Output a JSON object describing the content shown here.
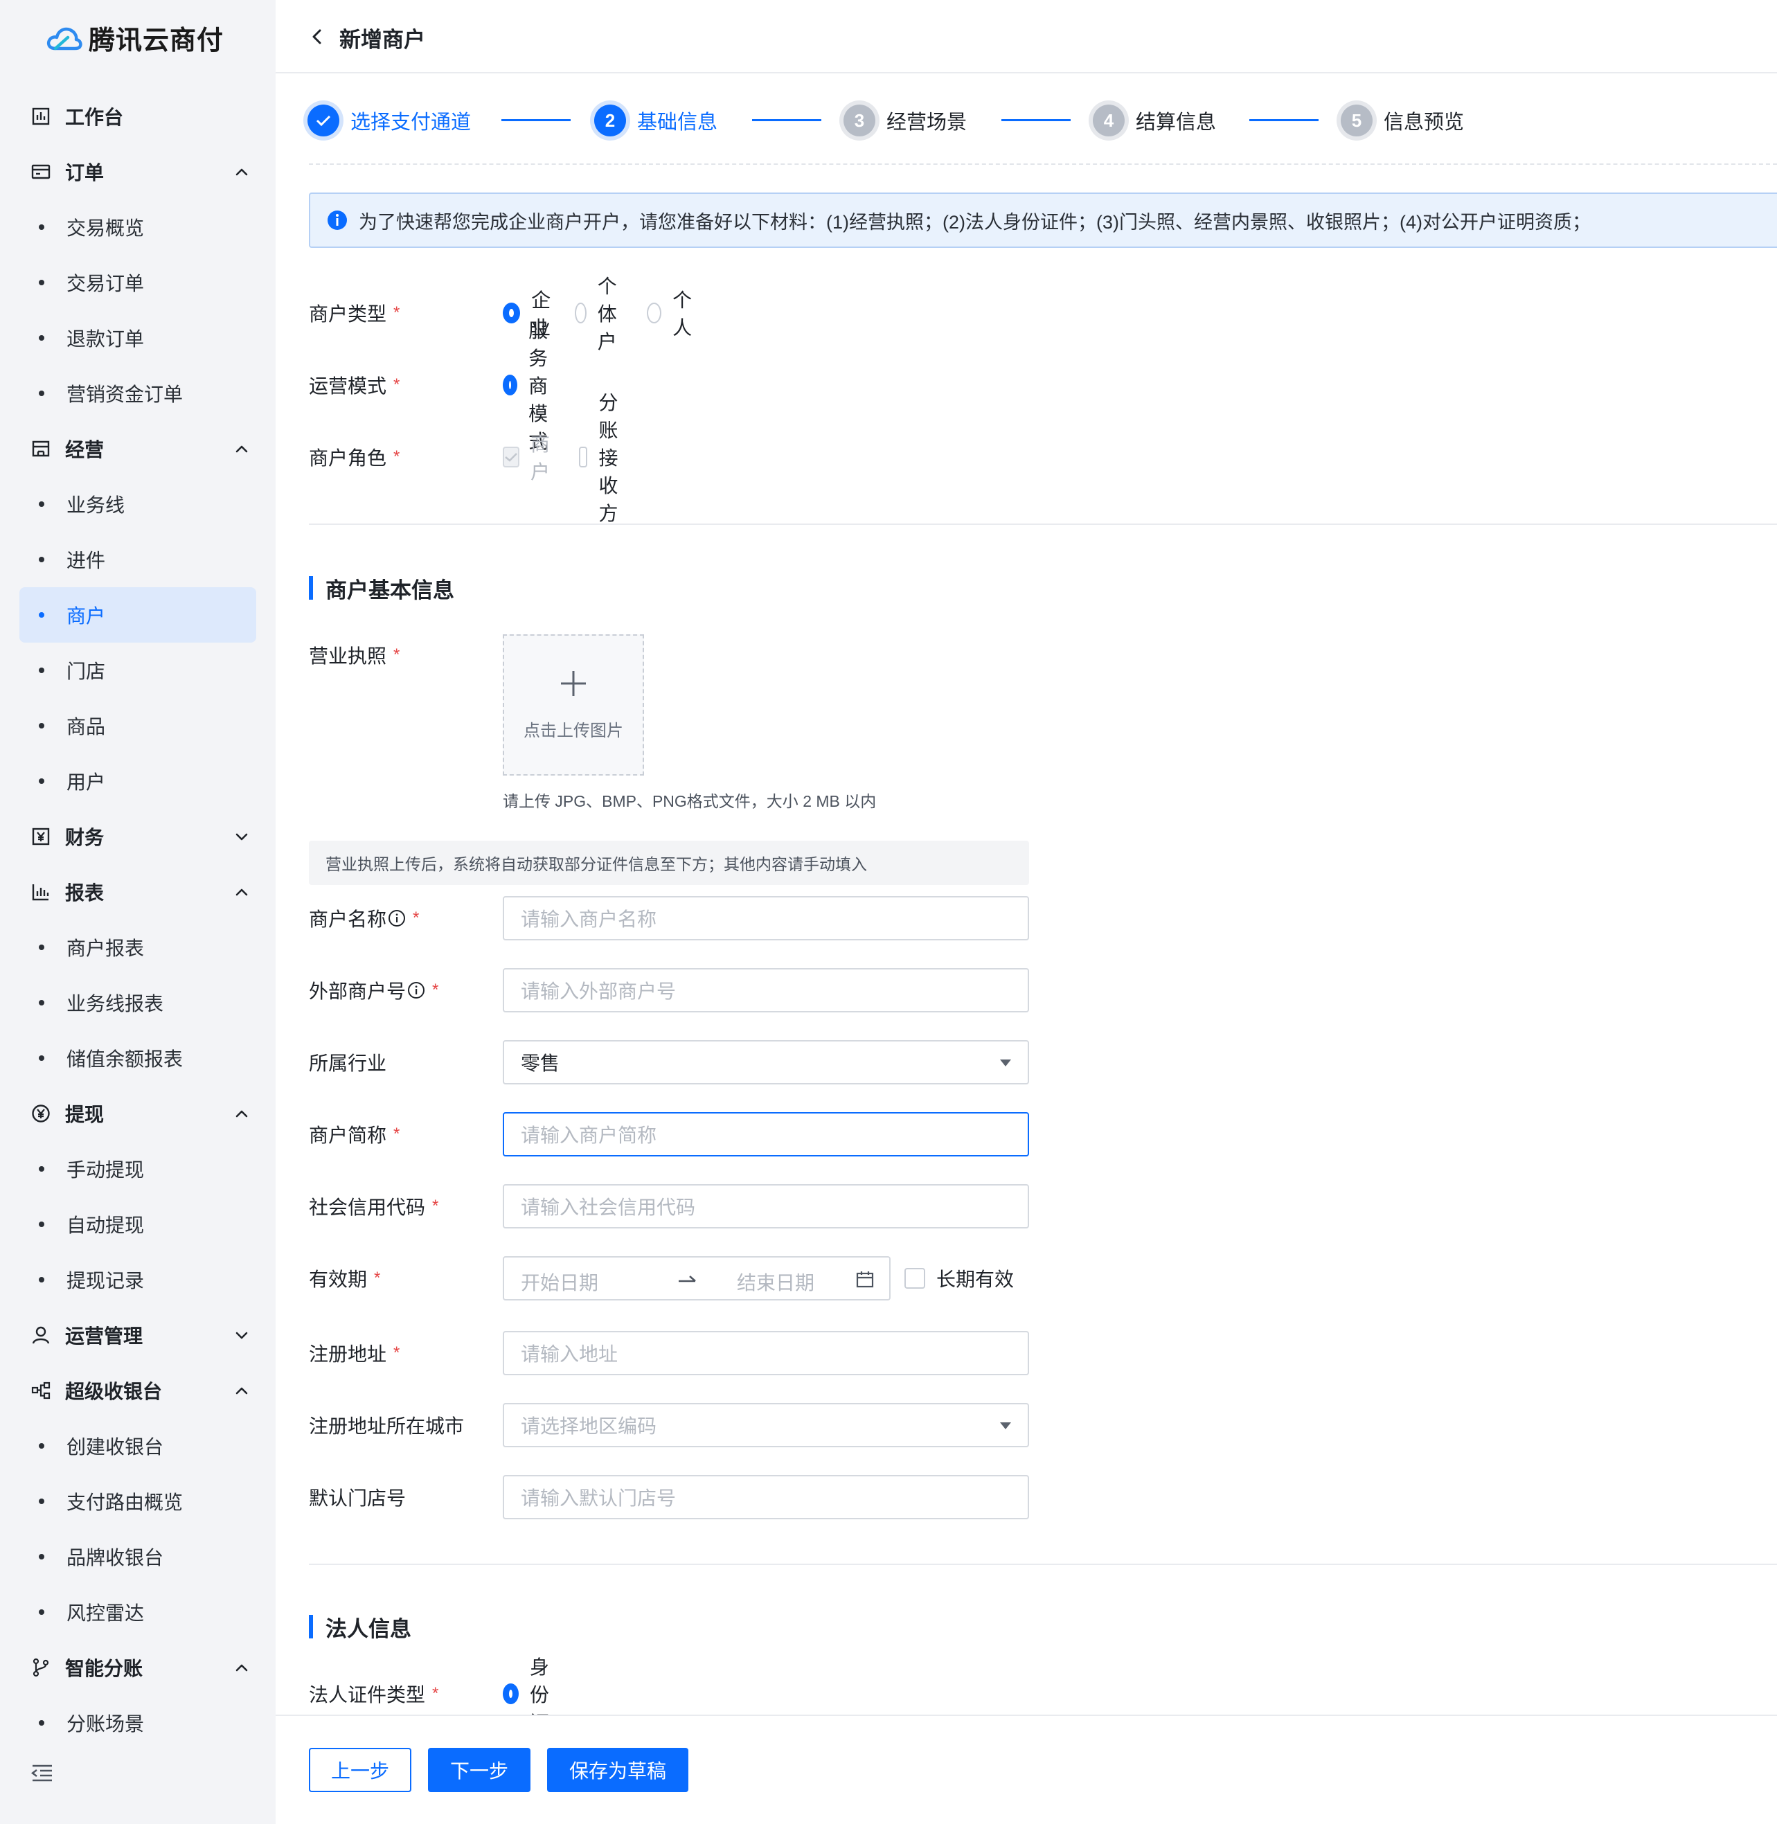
{
  "app": {
    "name": "腾讯云商付"
  },
  "sidebar": {
    "items": [
      {
        "type": "group",
        "label": "工作台",
        "icon": "dashboard-icon"
      },
      {
        "type": "group",
        "label": "订单",
        "icon": "order-icon",
        "expanded": true
      },
      {
        "type": "sub",
        "label": "交易概览"
      },
      {
        "type": "sub",
        "label": "交易订单"
      },
      {
        "type": "sub",
        "label": "退款订单"
      },
      {
        "type": "sub",
        "label": "营销资金订单"
      },
      {
        "type": "group",
        "label": "经营",
        "icon": "store-icon",
        "expanded": true
      },
      {
        "type": "sub",
        "label": "业务线"
      },
      {
        "type": "sub",
        "label": "进件"
      },
      {
        "type": "sub",
        "label": "商户",
        "active": true
      },
      {
        "type": "sub",
        "label": "门店"
      },
      {
        "type": "sub",
        "label": "商品"
      },
      {
        "type": "sub",
        "label": "用户"
      },
      {
        "type": "group",
        "label": "财务",
        "icon": "finance-icon",
        "expanded": false
      },
      {
        "type": "group",
        "label": "报表",
        "icon": "chart-icon",
        "expanded": true
      },
      {
        "type": "sub",
        "label": "商户报表"
      },
      {
        "type": "sub",
        "label": "业务线报表"
      },
      {
        "type": "sub",
        "label": "储值余额报表"
      },
      {
        "type": "group",
        "label": "提现",
        "icon": "withdraw-icon",
        "expanded": true
      },
      {
        "type": "sub",
        "label": "手动提现"
      },
      {
        "type": "sub",
        "label": "自动提现"
      },
      {
        "type": "sub",
        "label": "提现记录"
      },
      {
        "type": "group",
        "label": "运营管理",
        "icon": "user-icon",
        "expanded": false
      },
      {
        "type": "group",
        "label": "超级收银台",
        "icon": "cashier-icon",
        "expanded": true
      },
      {
        "type": "sub",
        "label": "创建收银台"
      },
      {
        "type": "sub",
        "label": "支付路由概览"
      },
      {
        "type": "sub",
        "label": "品牌收银台"
      },
      {
        "type": "sub",
        "label": "风控雷达"
      },
      {
        "type": "group",
        "label": "智能分账",
        "icon": "split-icon",
        "expanded": true
      },
      {
        "type": "sub",
        "label": "分账场景"
      }
    ]
  },
  "header": {
    "title": "新增商户"
  },
  "steps": [
    {
      "num": "1",
      "label": "选择支付通道",
      "state": "done"
    },
    {
      "num": "2",
      "label": "基础信息",
      "state": "current"
    },
    {
      "num": "3",
      "label": "经营场景",
      "state": "todo"
    },
    {
      "num": "4",
      "label": "结算信息",
      "state": "todo"
    },
    {
      "num": "5",
      "label": "信息预览",
      "state": "todo"
    }
  ],
  "notice": "为了快速帮您完成企业商户开户，请您准备好以下材料：(1)经营执照；(2)法人身份证件；(3)门头照、经营内景照、收银照片；(4)对公开户证明资质；",
  "form": {
    "merchant_type": {
      "label": "商户类型",
      "options": [
        "企业",
        "个体户",
        "个人"
      ],
      "selected": "企业"
    },
    "operation_mode": {
      "label": "运营模式",
      "options": [
        "服务商模式"
      ],
      "selected": "服务商模式"
    },
    "merchant_role": {
      "label": "商户角色",
      "options": [
        {
          "label": "商户",
          "checked": true,
          "disabled": true
        },
        {
          "label": "分账接收方",
          "checked": false,
          "disabled": false
        }
      ]
    }
  },
  "basic_info": {
    "title": "商户基本信息",
    "license": {
      "label": "营业执照",
      "upload_text": "点击上传图片",
      "hint": "请上传 JPG、BMP、PNG格式文件，大小 2 MB 以内"
    },
    "tip": "营业执照上传后，系统将自动获取部分证件信息至下方；其他内容请手动填入",
    "merchant_name": {
      "label": "商户名称",
      "placeholder": "请输入商户名称"
    },
    "external_id": {
      "label": "外部商户号",
      "placeholder": "请输入外部商户号"
    },
    "industry": {
      "label": "所属行业",
      "value": "零售"
    },
    "short_name": {
      "label": "商户简称",
      "placeholder": "请输入商户简称"
    },
    "credit_code": {
      "label": "社会信用代码",
      "placeholder": "请输入社会信用代码"
    },
    "validity": {
      "label": "有效期",
      "start_placeholder": "开始日期",
      "end_placeholder": "结束日期",
      "long_term": "长期有效"
    },
    "address": {
      "label": "注册地址",
      "placeholder": "请输入地址"
    },
    "city": {
      "label": "注册地址所在城市",
      "placeholder": "请选择地区编码"
    },
    "default_store": {
      "label": "默认门店号",
      "placeholder": "请输入默认门店号"
    }
  },
  "legal_info": {
    "title": "法人信息",
    "id_type": {
      "label": "法人证件类型",
      "selected": "身份证"
    }
  },
  "footer": {
    "prev": "上一步",
    "next": "下一步",
    "save_draft": "保存为草稿"
  },
  "colors": {
    "accent": "#0a6cff",
    "required": "#e54545",
    "sidebar_bg": "#f3f4f7",
    "active_bg": "#dde9fc"
  }
}
